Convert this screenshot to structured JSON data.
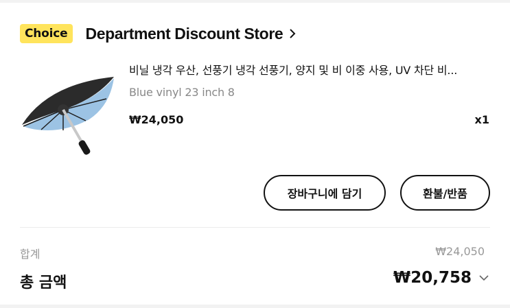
{
  "store": {
    "badge": "Choice",
    "name": "Department Discount Store",
    "badge_color": "#ffe45c"
  },
  "product": {
    "title": "비닐 냉각 우산, 선풍기 냉각 선풍기, 양지 및 비 이중 사용, UV 차단 비...",
    "variant": "Blue vinyl 23 inch 8",
    "price": "₩24,050",
    "quantity": "x1",
    "image": "umbrella-with-fan"
  },
  "actions": {
    "add_to_cart": "장바구니에 담기",
    "refund_return": "환불/반품"
  },
  "summary": {
    "subtotal_label": "합계",
    "subtotal_value": "₩24,050",
    "total_label": "총 금액",
    "total_value": "₩20,758"
  },
  "icons": {
    "store_link": "chevron-right-icon",
    "expand_total": "chevron-down-icon"
  }
}
